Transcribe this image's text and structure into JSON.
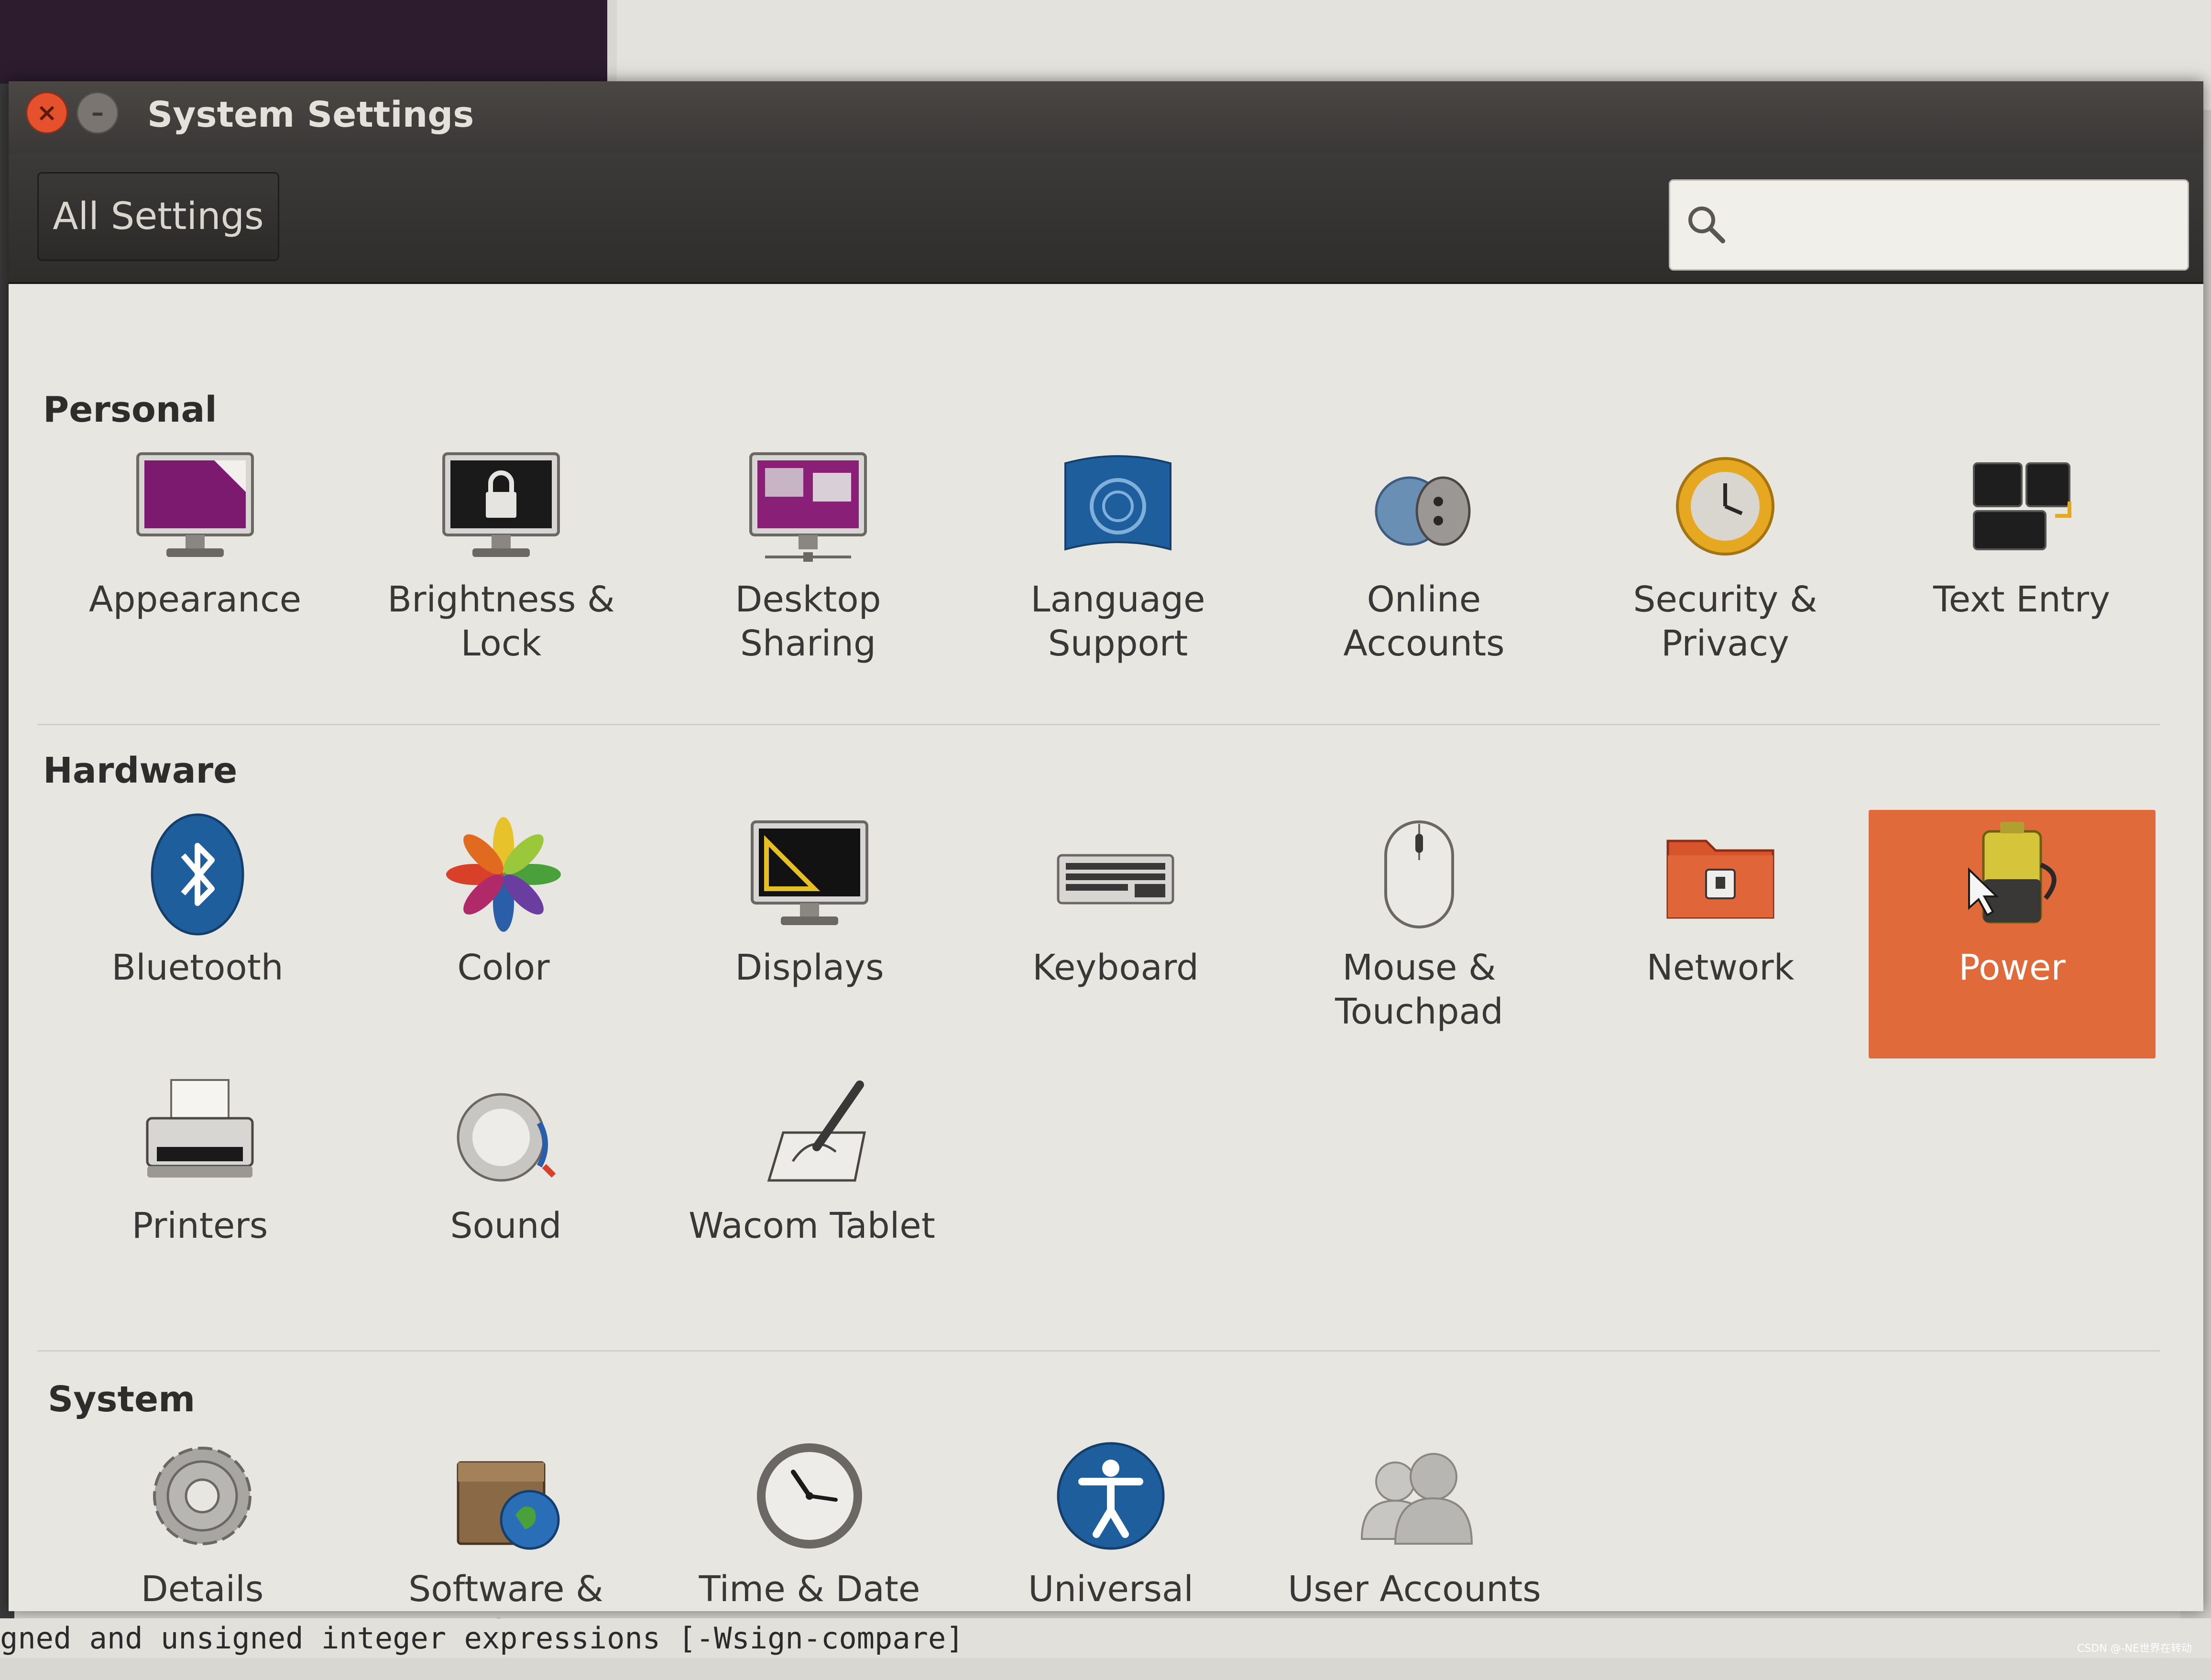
{
  "window": {
    "title": "System Settings",
    "all_settings_label": "All Settings",
    "search": {
      "placeholder": "",
      "value": ""
    }
  },
  "sections": {
    "personal": {
      "title": "Personal",
      "items": [
        {
          "label": "Appearance",
          "icon": "appearance-icon"
        },
        {
          "label": "Brightness &\nLock",
          "icon": "brightness-lock-icon"
        },
        {
          "label": "Desktop\nSharing",
          "icon": "desktop-sharing-icon"
        },
        {
          "label": "Language\nSupport",
          "icon": "language-support-icon"
        },
        {
          "label": "Online\nAccounts",
          "icon": "online-accounts-icon"
        },
        {
          "label": "Security &\nPrivacy",
          "icon": "security-privacy-icon"
        },
        {
          "label": "Text Entry",
          "icon": "text-entry-icon"
        }
      ]
    },
    "hardware": {
      "title": "Hardware",
      "items": [
        {
          "label": "Bluetooth",
          "icon": "bluetooth-icon"
        },
        {
          "label": "Color",
          "icon": "color-icon"
        },
        {
          "label": "Displays",
          "icon": "displays-icon"
        },
        {
          "label": "Keyboard",
          "icon": "keyboard-icon"
        },
        {
          "label": "Mouse &\nTouchpad",
          "icon": "mouse-touchpad-icon"
        },
        {
          "label": "Network",
          "icon": "network-icon"
        },
        {
          "label": "Power",
          "icon": "power-icon",
          "selected": true
        },
        {
          "label": "Printers",
          "icon": "printers-icon"
        },
        {
          "label": "Sound",
          "icon": "sound-icon"
        },
        {
          "label": "Wacom Tablet",
          "icon": "wacom-tablet-icon"
        }
      ]
    },
    "system": {
      "title": "System",
      "items": [
        {
          "label": "Details",
          "icon": "details-icon"
        },
        {
          "label": "Software &\nUpdates",
          "icon": "software-updates-icon"
        },
        {
          "label": "Time & Date",
          "icon": "time-date-icon"
        },
        {
          "label": "Universal\nAccess",
          "icon": "universal-access-icon"
        },
        {
          "label": "User Accounts",
          "icon": "user-accounts-icon"
        }
      ]
    }
  },
  "terminal_text": "gned and unsigned integer expressions [-Wsign-compare]",
  "watermark": "CSDN @-NE世界在转动",
  "colors": {
    "selected_bg": "#e06a3a",
    "titlebar": "#3c3a38",
    "close": "#e4512c"
  }
}
